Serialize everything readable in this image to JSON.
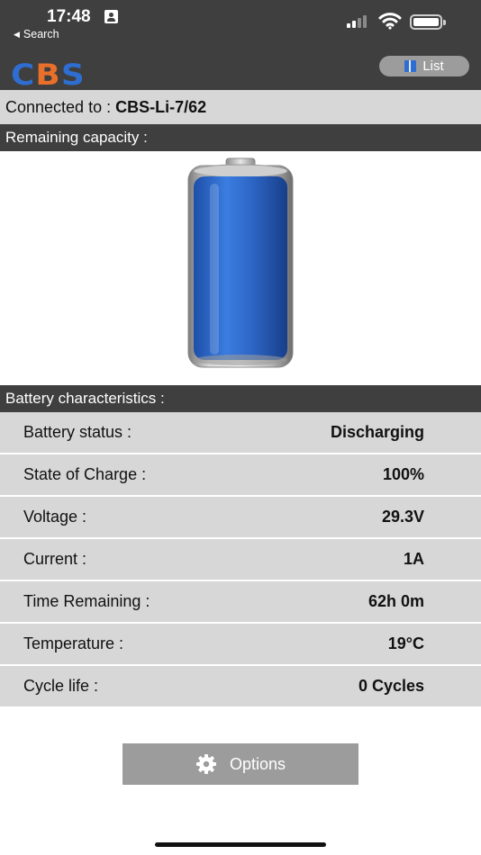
{
  "status_bar": {
    "time": "17:48",
    "back_label": "Search",
    "signal_bars_active": 2,
    "signal_bars_total": 4
  },
  "header": {
    "logo_letters": [
      "C",
      "B",
      "S"
    ],
    "logo_colors": [
      "#2f6ed1",
      "#e8702a",
      "#2f6ed1"
    ],
    "list_button_label": "List",
    "list_icon": "book-icon"
  },
  "connection": {
    "label": "Connected to :",
    "device_name": "CBS-Li-7/62"
  },
  "capacity": {
    "header": "Remaining capacity :",
    "fill_fraction": 1.0,
    "fill_color": "#2f6ed1"
  },
  "characteristics": {
    "header": "Battery characteristics :",
    "rows": [
      {
        "label": "Battery status :",
        "value": "Discharging"
      },
      {
        "label": "State of Charge :",
        "value": "100%"
      },
      {
        "label": "Voltage :",
        "value": "29.3V"
      },
      {
        "label": "Current :",
        "value": "1A"
      },
      {
        "label": "Time Remaining :",
        "value": "62h 0m"
      },
      {
        "label": "Temperature :",
        "value": "19°C"
      },
      {
        "label": "Cycle life :",
        "value": "0 Cycles"
      }
    ]
  },
  "options": {
    "label": "Options",
    "icon": "gear-icon"
  }
}
